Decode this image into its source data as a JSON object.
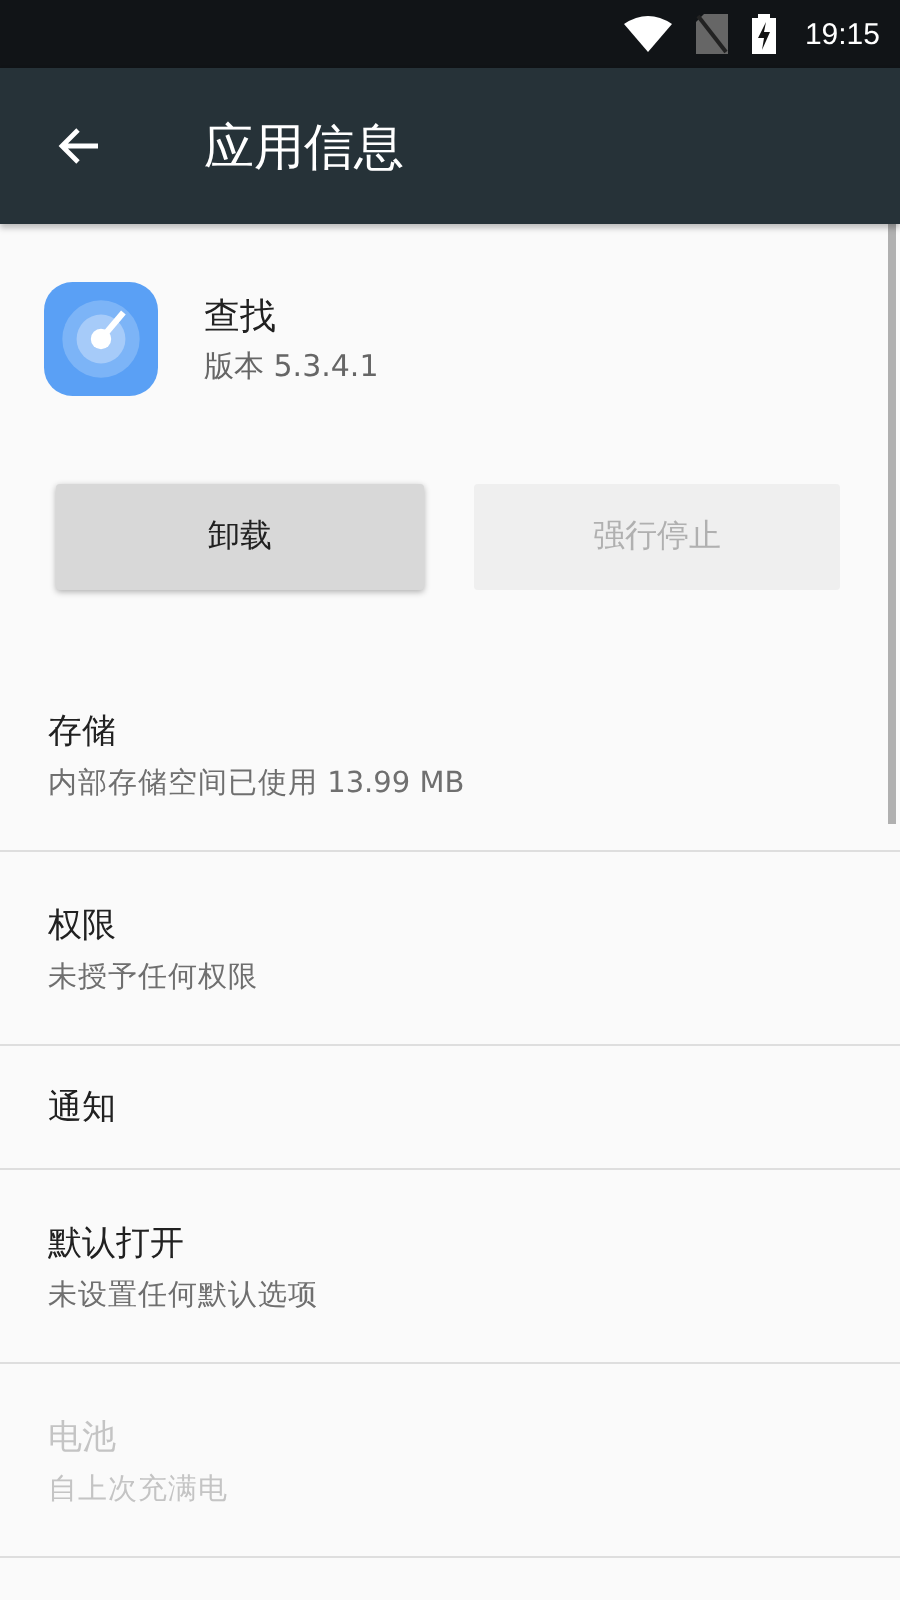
{
  "status_bar": {
    "time": "19:15"
  },
  "app_bar": {
    "title": "应用信息"
  },
  "app": {
    "name": "查找",
    "version": "版本 5.3.4.1"
  },
  "buttons": [
    {
      "label": "卸载",
      "disabled": false
    },
    {
      "label": "强行停止",
      "disabled": true
    }
  ],
  "items": [
    {
      "title": "存储",
      "subtitle": "内部存储空间已使用 13.99 MB",
      "disabled": false
    },
    {
      "title": "权限",
      "subtitle": "未授予任何权限",
      "disabled": false
    },
    {
      "title": "通知",
      "disabled": false
    },
    {
      "title": "默认打开",
      "subtitle": "未设置任何默认选项",
      "disabled": false
    },
    {
      "title": "电池",
      "subtitle": "自上次充满电",
      "disabled": true
    }
  ]
}
